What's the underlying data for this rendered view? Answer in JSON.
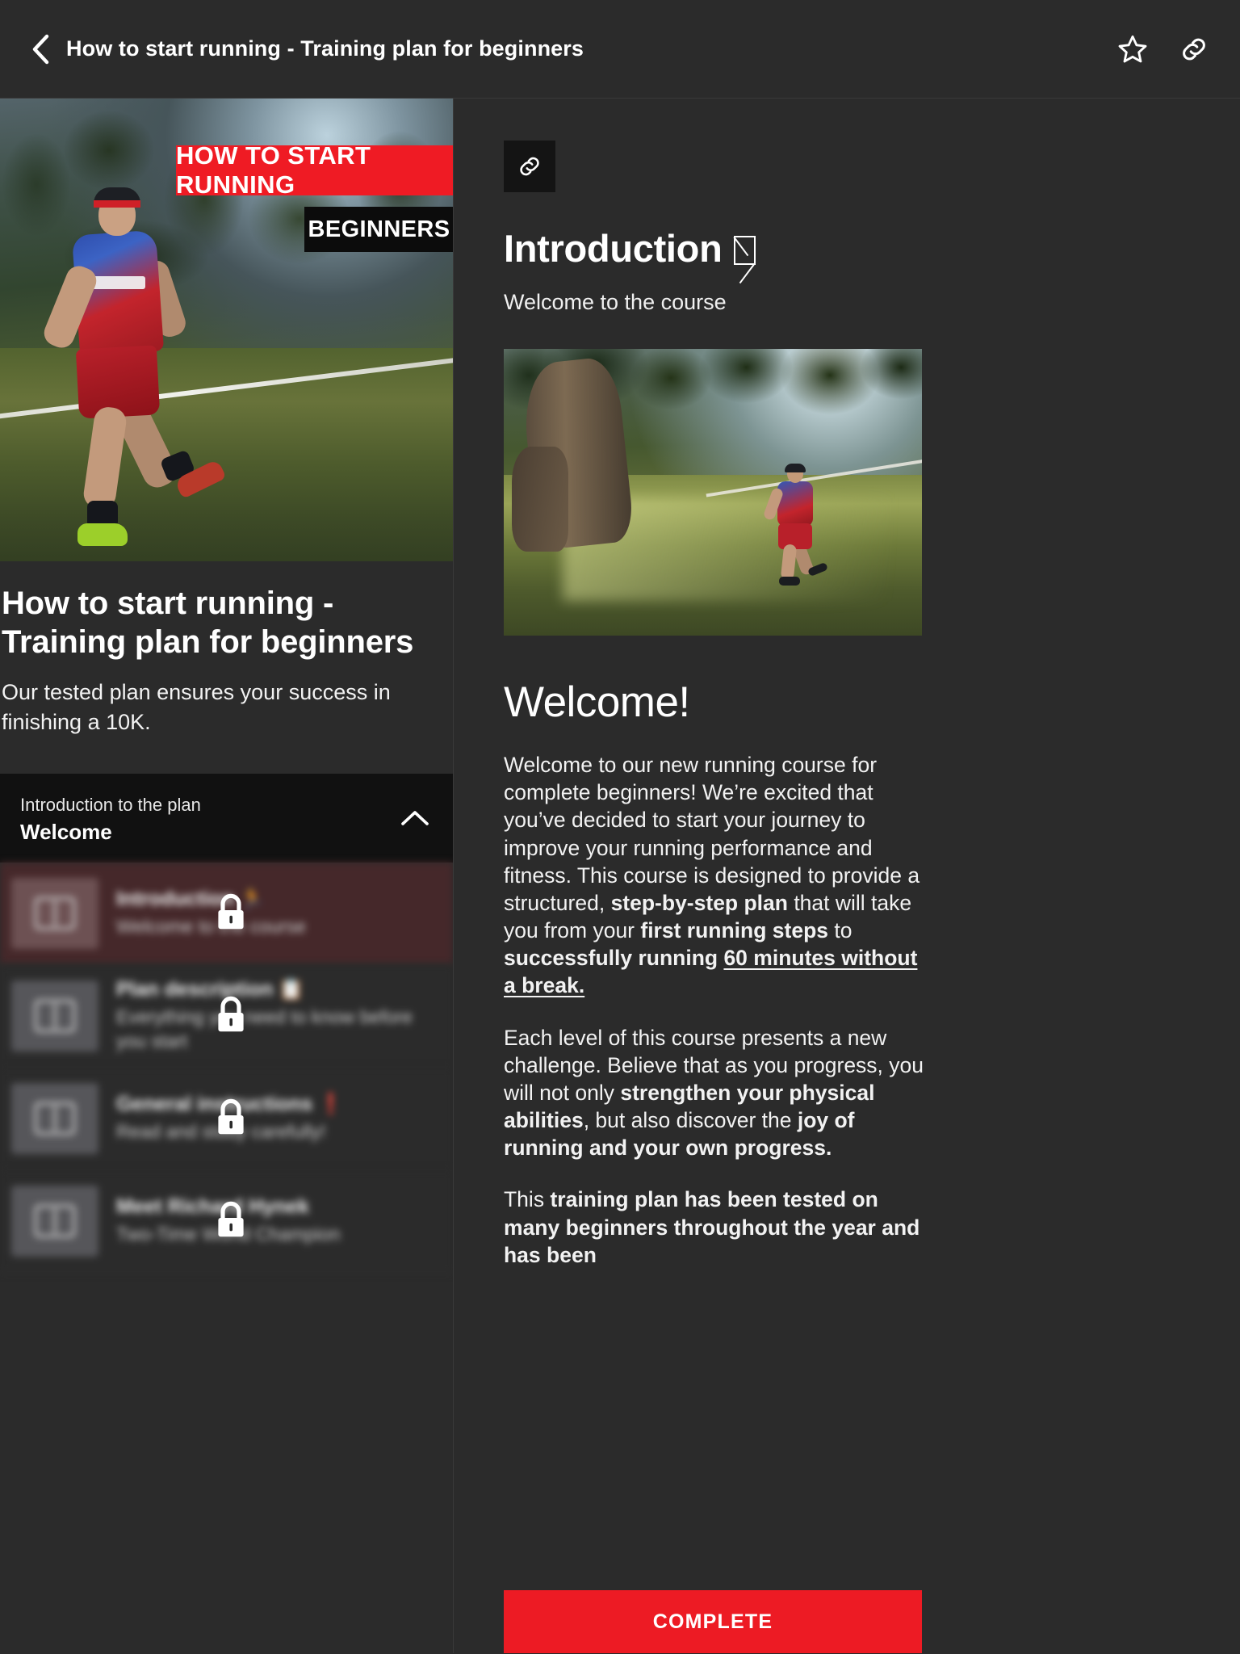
{
  "topbar": {
    "back_icon": "chevron-left-icon",
    "title": "How to start running - Training plan for beginners",
    "favorite_icon": "star-outline-icon",
    "share_icon": "link-icon"
  },
  "left": {
    "hero": {
      "banner_primary": "HOW TO START RUNNING",
      "banner_secondary": "BEGINNERS",
      "alt": "runner-in-olive-grove-thumbnail"
    },
    "course_title": "How to start running - Training plan for beginners",
    "course_subtitle": "Our tested plan ensures your success in finishing a 10K.",
    "section": {
      "kicker": "Introduction to the plan",
      "name": "Welcome",
      "collapse_icon": "chevron-up-icon"
    },
    "lessons": [
      {
        "title": "Introduction 🏃",
        "desc": "Welcome to the course",
        "locked": true,
        "active": true,
        "lock_icon": "lock-icon",
        "thumb_icon": "book-icon"
      },
      {
        "title": "Plan description 📋",
        "desc": "Everything you need to know before you start",
        "locked": true,
        "active": false,
        "lock_icon": "lock-icon",
        "thumb_icon": "book-icon"
      },
      {
        "title": "General instructions ❗",
        "desc": "Read and study carefully!",
        "locked": true,
        "active": false,
        "lock_icon": "lock-icon",
        "thumb_icon": "book-icon"
      },
      {
        "title": "Meet Richard Hynek",
        "desc": "Two-Time World Champion",
        "locked": true,
        "active": false,
        "lock_icon": "lock-icon",
        "thumb_icon": "book-icon"
      }
    ]
  },
  "right": {
    "link_chip_icon": "link-icon",
    "heading": "Introduction",
    "heading_glyph": "missing-glyph-box",
    "subheading": "Welcome to the course",
    "image_alt": "runner-passing-old-olive-tree",
    "welcome_heading": "Welcome!",
    "paragraphs": [
      {
        "id": "p1",
        "runs": [
          {
            "text": "Welcome to our new running course for complete beginners! We’re excited that you’ve decided to start your journey to improve your running performance and fitness. This course is designed to provide a structured, ",
            "style": "normal"
          },
          {
            "text": "step-by-step plan",
            "style": "bold"
          },
          {
            "text": " that will take you from your ",
            "style": "normal"
          },
          {
            "text": "first running steps",
            "style": "bold"
          },
          {
            "text": " to ",
            "style": "normal"
          },
          {
            "text": "successfully running ",
            "style": "bold"
          },
          {
            "text": "60 minutes without a break.",
            "style": "bold-underline"
          }
        ]
      },
      {
        "id": "p2",
        "runs": [
          {
            "text": "Each level of this course presents a new challenge. Believe that as you progress, you will not only ",
            "style": "normal"
          },
          {
            "text": "strengthen your physical abilities",
            "style": "bold"
          },
          {
            "text": ", but also discover the ",
            "style": "normal"
          },
          {
            "text": "joy of running and your own progress.",
            "style": "bold"
          }
        ]
      },
      {
        "id": "p3",
        "runs": [
          {
            "text": "This ",
            "style": "normal"
          },
          {
            "text": "training plan has been tested on many beginners throughout the year and has been",
            "style": "bold"
          }
        ]
      }
    ],
    "complete_button": "COMPLETE"
  },
  "colors": {
    "page_background": "#2b2b2b",
    "section_header_background": "#111111",
    "active_lesson_background": "#45282a",
    "accent_red": "#ed1b24",
    "banner_red": "#ef1b24",
    "text_primary": "#ffffff",
    "divider": "#3a3a3a"
  }
}
